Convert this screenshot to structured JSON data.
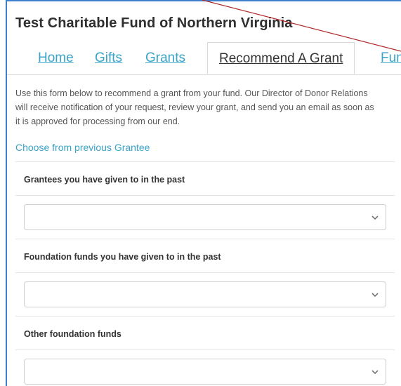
{
  "page": {
    "title": "Test Charitable Fund of Northern Virginia"
  },
  "tabs": [
    {
      "label": "Home"
    },
    {
      "label": "Gifts"
    },
    {
      "label": "Grants"
    },
    {
      "label": "Recommend A Grant",
      "active": true
    },
    {
      "label": "Fun"
    }
  ],
  "form": {
    "intro": "Use this form below to recommend a grant from your fund. Our Director of Donor Relations will receive notification of your request, review your grant, and send you an email as soon as it is approved for processing from our end.",
    "choose_link": "Choose from previous Grantee",
    "fields": [
      {
        "label": "Grantees you have given to in the past",
        "value": ""
      },
      {
        "label": "Foundation funds you have given to in the past",
        "value": ""
      },
      {
        "label": "Other foundation funds",
        "value": ""
      }
    ]
  },
  "colors": {
    "accent_link": "#3aa3c7",
    "frame_border": "#3f7fd0",
    "annotation_line": "#b0282a"
  },
  "icons": {
    "select_arrow": "chevron-down-icon"
  }
}
